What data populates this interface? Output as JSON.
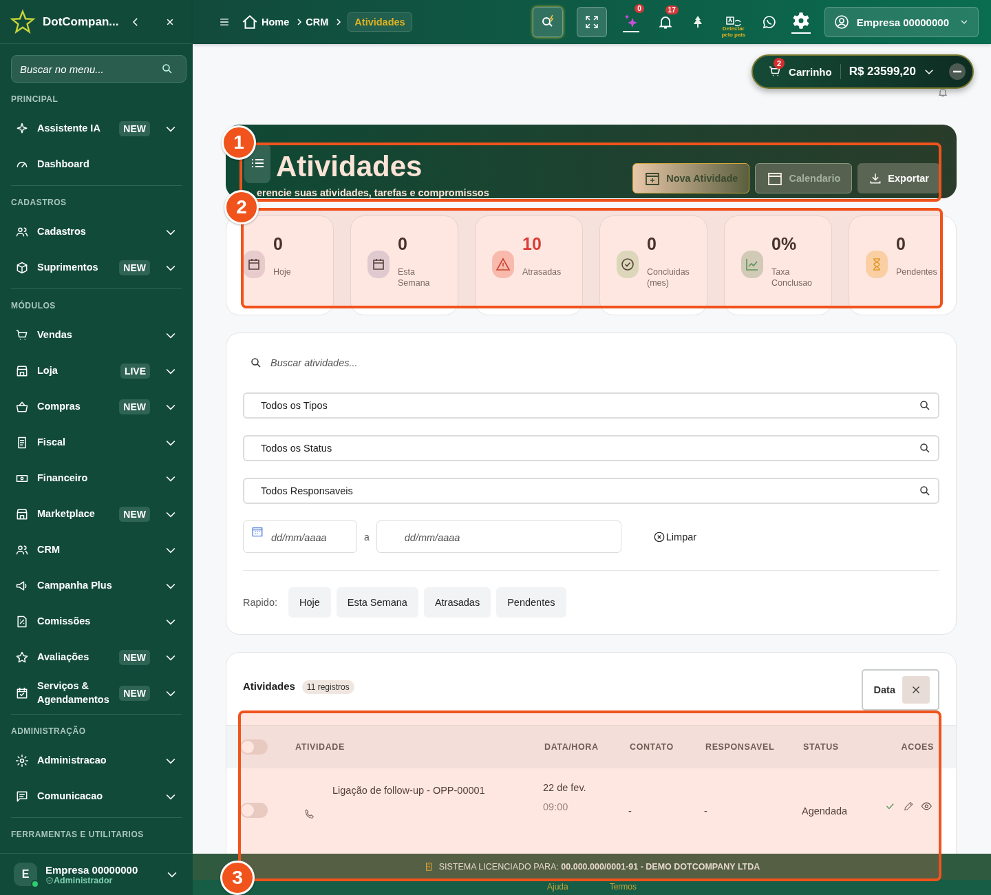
{
  "sidebar": {
    "brand": "DotCompan...",
    "search": {
      "placeholder": "Buscar no menu..."
    },
    "sections": [
      {
        "title": "PRINCIPAL",
        "items": [
          {
            "label": "Assistente IA",
            "badge": "NEW",
            "expandable": true
          },
          {
            "label": "Dashboard",
            "expandable": false
          }
        ]
      },
      {
        "title": "CADASTROS",
        "items": [
          {
            "label": "Cadastros",
            "expandable": true
          },
          {
            "label": "Suprimentos",
            "badge": "NEW",
            "expandable": true
          }
        ]
      },
      {
        "title": "MÓDULOS",
        "items": [
          {
            "label": "Vendas",
            "expandable": true
          },
          {
            "label": "Loja",
            "badge": "LIVE",
            "expandable": true
          },
          {
            "label": "Compras",
            "badge": "NEW",
            "expandable": true
          },
          {
            "label": "Fiscal",
            "expandable": true
          },
          {
            "label": "Financeiro",
            "expandable": true
          },
          {
            "label": "Marketplace",
            "badge": "NEW",
            "expandable": true
          },
          {
            "label": "CRM",
            "expandable": true
          },
          {
            "label": "Campanha Plus",
            "expandable": true
          },
          {
            "label": "Comissões",
            "expandable": true
          },
          {
            "label": "Avaliações",
            "badge": "NEW",
            "expandable": true
          },
          {
            "label": "Serviços & Agendamentos",
            "badge": "NEW",
            "expandable": true
          }
        ]
      },
      {
        "title": "ADMINISTRAÇÃO",
        "items": [
          {
            "label": "Administracao",
            "expandable": true
          },
          {
            "label": "Comunicacao",
            "expandable": true
          }
        ]
      },
      {
        "title": "FERRAMENTAS E UTILITARIOS"
      }
    ],
    "user": {
      "avatar": "E",
      "name": "Empresa 00000000",
      "role": "Administrador"
    }
  },
  "topbar": {
    "breadcrumb": [
      "Home",
      "CRM"
    ],
    "current": "Atividades",
    "ai_count": "0",
    "notifications": "17",
    "language_hint": "Detectar pelo pais",
    "account": "Empresa 00000000"
  },
  "cart": {
    "count": "2",
    "label": "Carrinho",
    "total": "R$ 23599,20"
  },
  "header": {
    "title": "Atividades",
    "subtitle": "erencie suas atividades, tarefas e compromissos",
    "buttons": [
      {
        "label": "Nova Atividade",
        "kind": "primary"
      },
      {
        "label": "Calendario",
        "kind": "disabled"
      },
      {
        "label": "Exportar",
        "kind": "secondary"
      }
    ]
  },
  "stats": [
    {
      "value": "0",
      "label": "Hoje",
      "alert": false
    },
    {
      "value": "0",
      "label": "Esta Semana",
      "alert": false
    },
    {
      "value": "10",
      "label": "Atrasadas",
      "alert": true
    },
    {
      "value": "0",
      "label": "Concluidas (mes)",
      "alert": false
    },
    {
      "value": "0%",
      "label": "Taxa Conclusao",
      "alert": false
    },
    {
      "value": "0",
      "label": "Pendentes",
      "alert": false
    }
  ],
  "filters": {
    "search": {
      "placeholder": "Buscar atividades..."
    },
    "selects": [
      "Todos os Tipos",
      "Todos os Status",
      "Todos Responsaveis"
    ],
    "date_from": {
      "placeholder": "dd/mm/aaaa"
    },
    "separator": "a",
    "date_to": {
      "placeholder": "dd/mm/aaaa"
    },
    "clear": "Limpar",
    "quick_label": "Rapido:",
    "quick": [
      "Hoje",
      "Esta Semana",
      "Atrasadas",
      "Pendentes"
    ]
  },
  "table": {
    "select_all": false,
    "title": "Atividades",
    "count": "11 registros",
    "sort": "Data",
    "columns": [
      "ATIVIDADE",
      "DATA/HORA",
      "CONTATO",
      "RESPONSAVEL",
      "STATUS",
      "ACOES"
    ],
    "rows": [
      {
        "selected": false,
        "activity": "Ligação de follow-up - OPP-00001",
        "date": "22 de fev.",
        "time": "09:00",
        "contact": "-",
        "owner": "-",
        "status": "Agendada"
      }
    ]
  },
  "status_bar": {
    "label": "SISTEMA LICENCIADO PARA:",
    "license": "00.000.000/0001-91 - DEMO DOTCOMPANY LTDA",
    "links": [
      "Ajuda",
      "Termos"
    ]
  },
  "annotations": [
    {
      "label": "1"
    },
    {
      "label": "2"
    },
    {
      "label": "3"
    }
  ]
}
